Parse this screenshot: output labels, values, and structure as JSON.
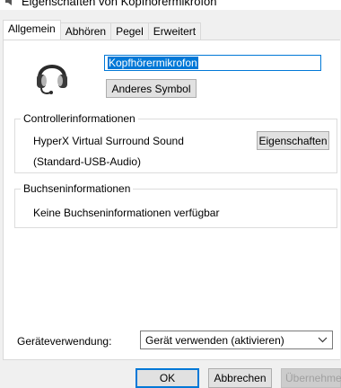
{
  "window": {
    "title": "Eigenschaften von Kopfhörermikrofon",
    "icon": "speaker-icon"
  },
  "tabs": [
    {
      "label": "Allgemein",
      "active": true
    },
    {
      "label": "Abhören",
      "active": false
    },
    {
      "label": "Pegel",
      "active": false
    },
    {
      "label": "Erweitert",
      "active": false
    }
  ],
  "general": {
    "device_icon": "headset-icon",
    "device_name": "Kopfhörermikrofon",
    "change_symbol_label": "Anderes Symbol"
  },
  "controller": {
    "legend": "Controllerinformationen",
    "name": "HyperX Virtual Surround Sound",
    "driver": "(Standard-USB-Audio)",
    "properties_label": "Eigenschaften"
  },
  "jack": {
    "legend": "Buchseninformationen",
    "text": "Keine Buchseninformationen verfügbar"
  },
  "usage": {
    "label": "Geräteverwendung:",
    "selected": "Gerät verwenden (aktivieren)"
  },
  "footer": {
    "ok": "OK",
    "cancel": "Abbrechen",
    "apply": "Übernehmen"
  },
  "colors": {
    "accent": "#0078d7",
    "window_bg": "#f0f0f0",
    "panel_bg": "#ffffff"
  }
}
